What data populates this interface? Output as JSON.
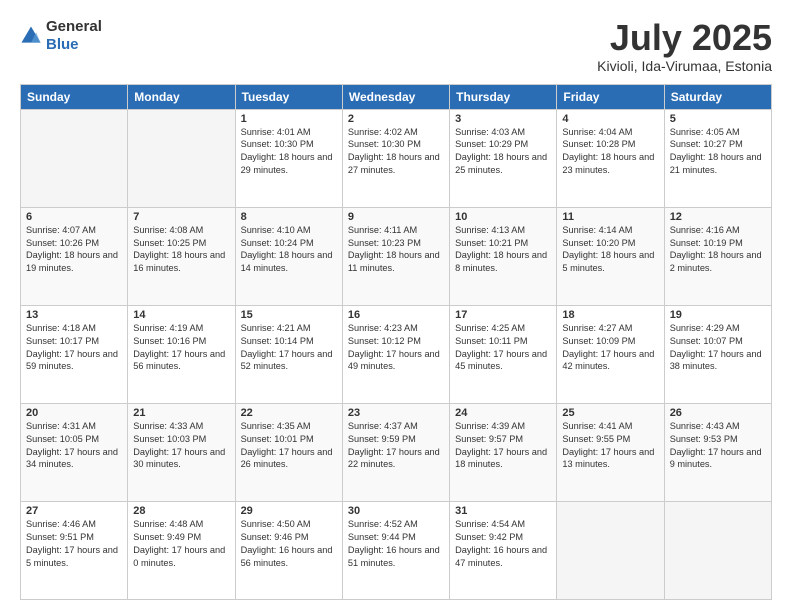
{
  "header": {
    "logo_line1": "General",
    "logo_line2": "Blue",
    "month_year": "July 2025",
    "location": "Kivioli, Ida-Virumaa, Estonia"
  },
  "weekdays": [
    "Sunday",
    "Monday",
    "Tuesday",
    "Wednesday",
    "Thursday",
    "Friday",
    "Saturday"
  ],
  "weeks": [
    [
      {
        "day": "",
        "sunrise": "",
        "sunset": "",
        "daylight": "",
        "empty": true
      },
      {
        "day": "",
        "sunrise": "",
        "sunset": "",
        "daylight": "",
        "empty": true
      },
      {
        "day": "1",
        "sunrise": "Sunrise: 4:01 AM",
        "sunset": "Sunset: 10:30 PM",
        "daylight": "Daylight: 18 hours and 29 minutes."
      },
      {
        "day": "2",
        "sunrise": "Sunrise: 4:02 AM",
        "sunset": "Sunset: 10:30 PM",
        "daylight": "Daylight: 18 hours and 27 minutes."
      },
      {
        "day": "3",
        "sunrise": "Sunrise: 4:03 AM",
        "sunset": "Sunset: 10:29 PM",
        "daylight": "Daylight: 18 hours and 25 minutes."
      },
      {
        "day": "4",
        "sunrise": "Sunrise: 4:04 AM",
        "sunset": "Sunset: 10:28 PM",
        "daylight": "Daylight: 18 hours and 23 minutes."
      },
      {
        "day": "5",
        "sunrise": "Sunrise: 4:05 AM",
        "sunset": "Sunset: 10:27 PM",
        "daylight": "Daylight: 18 hours and 21 minutes."
      }
    ],
    [
      {
        "day": "6",
        "sunrise": "Sunrise: 4:07 AM",
        "sunset": "Sunset: 10:26 PM",
        "daylight": "Daylight: 18 hours and 19 minutes."
      },
      {
        "day": "7",
        "sunrise": "Sunrise: 4:08 AM",
        "sunset": "Sunset: 10:25 PM",
        "daylight": "Daylight: 18 hours and 16 minutes."
      },
      {
        "day": "8",
        "sunrise": "Sunrise: 4:10 AM",
        "sunset": "Sunset: 10:24 PM",
        "daylight": "Daylight: 18 hours and 14 minutes."
      },
      {
        "day": "9",
        "sunrise": "Sunrise: 4:11 AM",
        "sunset": "Sunset: 10:23 PM",
        "daylight": "Daylight: 18 hours and 11 minutes."
      },
      {
        "day": "10",
        "sunrise": "Sunrise: 4:13 AM",
        "sunset": "Sunset: 10:21 PM",
        "daylight": "Daylight: 18 hours and 8 minutes."
      },
      {
        "day": "11",
        "sunrise": "Sunrise: 4:14 AM",
        "sunset": "Sunset: 10:20 PM",
        "daylight": "Daylight: 18 hours and 5 minutes."
      },
      {
        "day": "12",
        "sunrise": "Sunrise: 4:16 AM",
        "sunset": "Sunset: 10:19 PM",
        "daylight": "Daylight: 18 hours and 2 minutes."
      }
    ],
    [
      {
        "day": "13",
        "sunrise": "Sunrise: 4:18 AM",
        "sunset": "Sunset: 10:17 PM",
        "daylight": "Daylight: 17 hours and 59 minutes."
      },
      {
        "day": "14",
        "sunrise": "Sunrise: 4:19 AM",
        "sunset": "Sunset: 10:16 PM",
        "daylight": "Daylight: 17 hours and 56 minutes."
      },
      {
        "day": "15",
        "sunrise": "Sunrise: 4:21 AM",
        "sunset": "Sunset: 10:14 PM",
        "daylight": "Daylight: 17 hours and 52 minutes."
      },
      {
        "day": "16",
        "sunrise": "Sunrise: 4:23 AM",
        "sunset": "Sunset: 10:12 PM",
        "daylight": "Daylight: 17 hours and 49 minutes."
      },
      {
        "day": "17",
        "sunrise": "Sunrise: 4:25 AM",
        "sunset": "Sunset: 10:11 PM",
        "daylight": "Daylight: 17 hours and 45 minutes."
      },
      {
        "day": "18",
        "sunrise": "Sunrise: 4:27 AM",
        "sunset": "Sunset: 10:09 PM",
        "daylight": "Daylight: 17 hours and 42 minutes."
      },
      {
        "day": "19",
        "sunrise": "Sunrise: 4:29 AM",
        "sunset": "Sunset: 10:07 PM",
        "daylight": "Daylight: 17 hours and 38 minutes."
      }
    ],
    [
      {
        "day": "20",
        "sunrise": "Sunrise: 4:31 AM",
        "sunset": "Sunset: 10:05 PM",
        "daylight": "Daylight: 17 hours and 34 minutes."
      },
      {
        "day": "21",
        "sunrise": "Sunrise: 4:33 AM",
        "sunset": "Sunset: 10:03 PM",
        "daylight": "Daylight: 17 hours and 30 minutes."
      },
      {
        "day": "22",
        "sunrise": "Sunrise: 4:35 AM",
        "sunset": "Sunset: 10:01 PM",
        "daylight": "Daylight: 17 hours and 26 minutes."
      },
      {
        "day": "23",
        "sunrise": "Sunrise: 4:37 AM",
        "sunset": "Sunset: 9:59 PM",
        "daylight": "Daylight: 17 hours and 22 minutes."
      },
      {
        "day": "24",
        "sunrise": "Sunrise: 4:39 AM",
        "sunset": "Sunset: 9:57 PM",
        "daylight": "Daylight: 17 hours and 18 minutes."
      },
      {
        "day": "25",
        "sunrise": "Sunrise: 4:41 AM",
        "sunset": "Sunset: 9:55 PM",
        "daylight": "Daylight: 17 hours and 13 minutes."
      },
      {
        "day": "26",
        "sunrise": "Sunrise: 4:43 AM",
        "sunset": "Sunset: 9:53 PM",
        "daylight": "Daylight: 17 hours and 9 minutes."
      }
    ],
    [
      {
        "day": "27",
        "sunrise": "Sunrise: 4:46 AM",
        "sunset": "Sunset: 9:51 PM",
        "daylight": "Daylight: 17 hours and 5 minutes."
      },
      {
        "day": "28",
        "sunrise": "Sunrise: 4:48 AM",
        "sunset": "Sunset: 9:49 PM",
        "daylight": "Daylight: 17 hours and 0 minutes."
      },
      {
        "day": "29",
        "sunrise": "Sunrise: 4:50 AM",
        "sunset": "Sunset: 9:46 PM",
        "daylight": "Daylight: 16 hours and 56 minutes."
      },
      {
        "day": "30",
        "sunrise": "Sunrise: 4:52 AM",
        "sunset": "Sunset: 9:44 PM",
        "daylight": "Daylight: 16 hours and 51 minutes."
      },
      {
        "day": "31",
        "sunrise": "Sunrise: 4:54 AM",
        "sunset": "Sunset: 9:42 PM",
        "daylight": "Daylight: 16 hours and 47 minutes."
      },
      {
        "day": "",
        "sunrise": "",
        "sunset": "",
        "daylight": "",
        "empty": true
      },
      {
        "day": "",
        "sunrise": "",
        "sunset": "",
        "daylight": "",
        "empty": true
      }
    ]
  ]
}
